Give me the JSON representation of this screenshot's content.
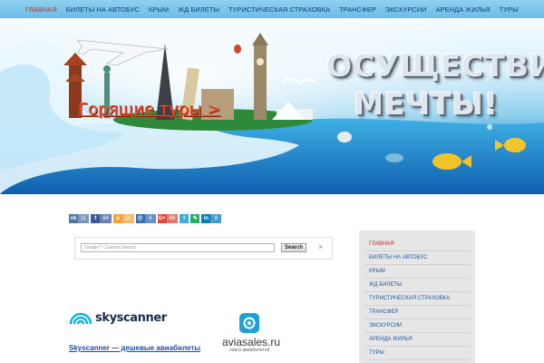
{
  "nav": {
    "items": [
      {
        "label": "ГЛАВНАЯ",
        "active": true
      },
      {
        "label": "БИЛЕТЫ НА АВТОБУС"
      },
      {
        "label": "КРЫМ"
      },
      {
        "label": "ЖД БИЛЕТЫ"
      },
      {
        "label": "ТУРИСТИЧЕСКАЯ СТРАХОВКА"
      },
      {
        "label": "ТРАНСФЕР"
      },
      {
        "label": "ЭКСКУРСИИ"
      },
      {
        "label": "АРЕНДА ЖИЛЬЯ"
      },
      {
        "label": "ТУРЫ"
      }
    ]
  },
  "hero": {
    "headline_line1": "ОСУЩЕСТВИ",
    "headline_line2": "МЕЧТЫ!",
    "promo_link": "Горящие туры >"
  },
  "share": [
    {
      "service": "vk",
      "icon": "vk-icon",
      "glyph": "vk",
      "count": "11",
      "color": "#4d76a1"
    },
    {
      "service": "facebook",
      "icon": "facebook-icon",
      "glyph": "f",
      "count": "84",
      "color": "#3b5998"
    },
    {
      "service": "odnoklassniki",
      "icon": "odnoklassniki-icon",
      "glyph": "о",
      "count": "10",
      "color": "#f4a234"
    },
    {
      "service": "mailru",
      "icon": "mailru-icon",
      "glyph": "@",
      "count": "4",
      "color": "#2f6fb1"
    },
    {
      "service": "googleplus",
      "icon": "googleplus-icon",
      "glyph": "G+",
      "count": "86",
      "color": "#dd4b39"
    },
    {
      "service": "twitter",
      "icon": "twitter-icon",
      "glyph": "t",
      "count": "",
      "color": "#41abe1"
    },
    {
      "service": "livejournal",
      "icon": "livejournal-icon",
      "glyph": "✎",
      "count": "",
      "color": "#2aab66"
    },
    {
      "service": "linkedin",
      "icon": "linkedin-icon",
      "glyph": "in",
      "count": "9",
      "color": "#0a7bb7"
    }
  ],
  "search": {
    "placeholder": "Google™ Custom Search",
    "button_label": "Search",
    "close_glyph": "×"
  },
  "skyscanner": {
    "logo_text": "skyscanner",
    "tagline": "Skyscanner — дешевые авиабилеты"
  },
  "aviasales": {
    "name": "aviasales.ru",
    "subtitle": "поиск авиабилетов"
  },
  "sidebar": {
    "items": [
      {
        "label": "ГЛАВНАЯ",
        "active": true
      },
      {
        "label": "БИЛЕТЫ НА АВТОБУС"
      },
      {
        "label": "КРЫМ"
      },
      {
        "label": "ЖД БИЛЕТЫ"
      },
      {
        "label": "ТУРИСТИЧЕСКАЯ СТРАХОВКА"
      },
      {
        "label": "ТРАНСФЕР"
      },
      {
        "label": "ЭКСКУРСИИ"
      },
      {
        "label": "АРЕНДА ЖИЛЬЯ"
      },
      {
        "label": "ТУРЫ"
      }
    ]
  },
  "colors": {
    "nav_text": "#0d3b75",
    "active": "#c0281c",
    "link": "#1d5a9a"
  }
}
